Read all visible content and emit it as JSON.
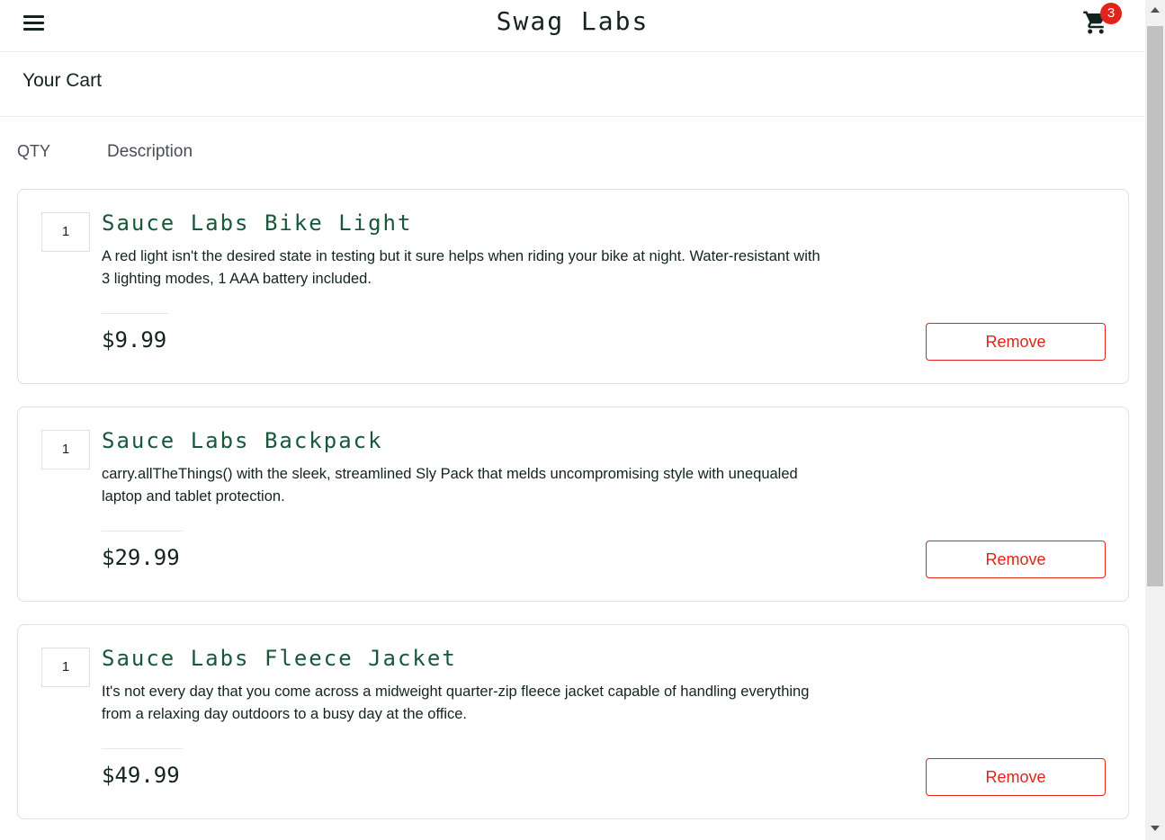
{
  "header": {
    "app_logo": "Swag Labs",
    "cart_badge": "3",
    "menu_icon": "hamburger-menu-icon",
    "cart_icon": "shopping-cart-icon"
  },
  "page": {
    "title": "Your Cart"
  },
  "columns": {
    "qty": "QTY",
    "description": "Description"
  },
  "cart_items": [
    {
      "quantity": "1",
      "name": "Sauce Labs Bike Light",
      "description": "A red light isn't the desired state in testing but it sure helps when riding your bike at night. Water-resistant with 3 lighting modes, 1 AAA battery included.",
      "price": "$9.99",
      "remove_label": "Remove"
    },
    {
      "quantity": "1",
      "name": "Sauce Labs Backpack",
      "description": "carry.allTheThings() with the sleek, streamlined Sly Pack that melds uncompromising style with unequaled laptop and tablet protection.",
      "price": "$29.99",
      "remove_label": "Remove"
    },
    {
      "quantity": "1",
      "name": "Sauce Labs Fleece Jacket",
      "description": "It's not every day that you come across a midweight quarter-zip fleece jacket capable of handling everything from a relaxing day outdoors to a busy day at the office.",
      "price": "$49.99",
      "remove_label": "Remove"
    }
  ],
  "colors": {
    "accent_green": "#18583a",
    "remove_red": "#e2231a",
    "text": "#132322"
  }
}
